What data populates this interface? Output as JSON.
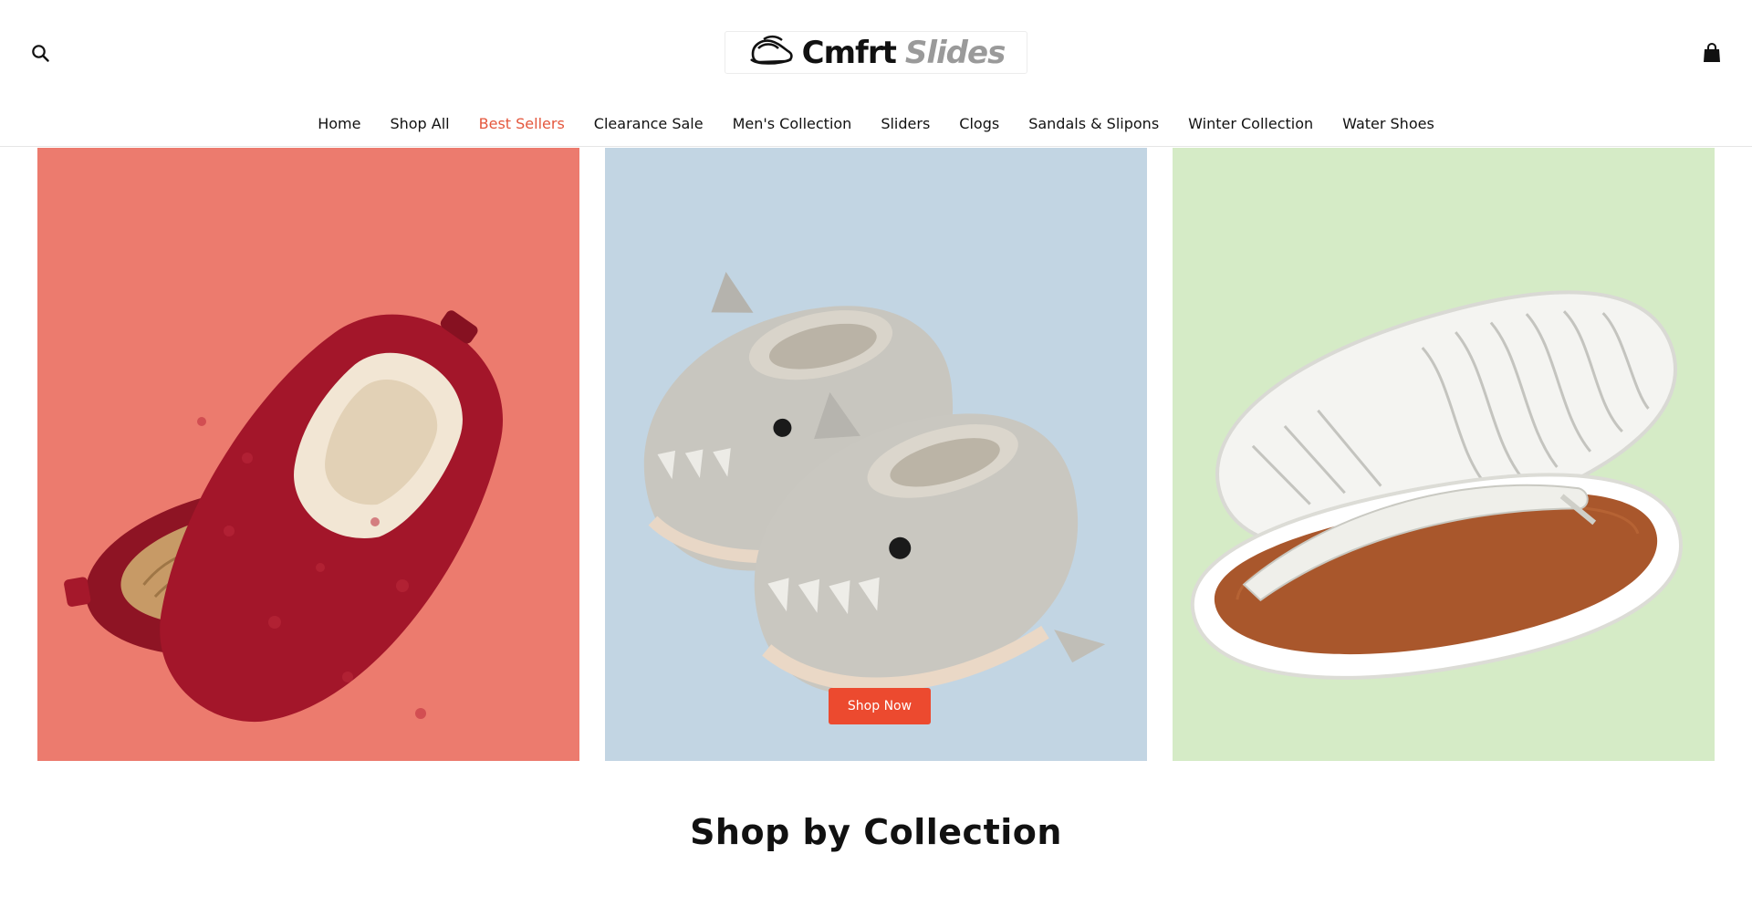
{
  "header": {
    "logo": {
      "word1": "Cmfrt",
      "word2": "Slides",
      "icon": "slipper-icon"
    },
    "search_icon": "search-icon",
    "cart_icon": "shopping-bag-icon"
  },
  "nav": {
    "items": [
      {
        "label": "Home",
        "active": false
      },
      {
        "label": "Shop All",
        "active": false
      },
      {
        "label": "Best Sellers",
        "active": true
      },
      {
        "label": "Clearance Sale",
        "active": false
      },
      {
        "label": "Men's Collection",
        "active": false
      },
      {
        "label": "Sliders",
        "active": false
      },
      {
        "label": "Clogs",
        "active": false
      },
      {
        "label": "Sandals & Slipons",
        "active": false
      },
      {
        "label": "Winter Collection",
        "active": false
      },
      {
        "label": "Water Shoes",
        "active": false
      }
    ],
    "active_color": "#e4573d"
  },
  "hero": {
    "panels": [
      {
        "image": "red-fleece-slippers",
        "background": "#ec7b6e"
      },
      {
        "image": "grey-shark-slides",
        "background": "#c2d5e3",
        "cta_label": "Shop Now"
      },
      {
        "image": "white-flip-flops",
        "background": "#d5ebc6"
      }
    ],
    "cta_color": "#ec4a2f"
  },
  "sections": {
    "collection_title": "Shop by Collection"
  }
}
